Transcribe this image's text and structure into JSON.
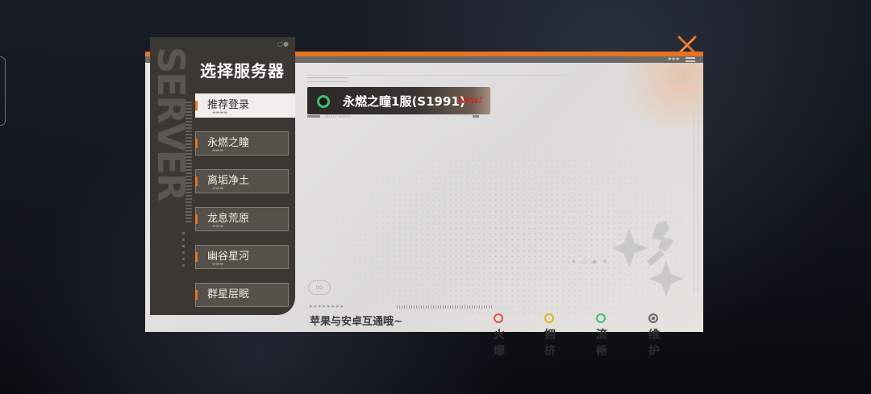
{
  "dialog": {
    "title": "选择服务器",
    "close_icon": "close-x-icon",
    "footer_note": "苹果与安卓互通哦~",
    "accent_color": "#e8741f"
  },
  "sidebar": {
    "items": [
      {
        "label": "推荐登录",
        "active": true
      },
      {
        "label": "永燃之瞳",
        "active": false
      },
      {
        "label": "离垢净土",
        "active": false
      },
      {
        "label": "龙息荒原",
        "active": false
      },
      {
        "label": "幽谷星河",
        "active": false
      },
      {
        "label": "群星层眠",
        "active": false
      }
    ]
  },
  "servers": [
    {
      "name": "永燃之瞳1服(S1991)",
      "badge": "New!",
      "status": "流畅",
      "status_color": "#3fbf72"
    }
  ],
  "legend": [
    {
      "label": "火爆",
      "color": "#e84a4a"
    },
    {
      "label": "拥挤",
      "color": "#e0b21c"
    },
    {
      "label": "流畅",
      "color": "#3fbf72"
    },
    {
      "label": "维护",
      "color": "#6a6a6a"
    }
  ]
}
